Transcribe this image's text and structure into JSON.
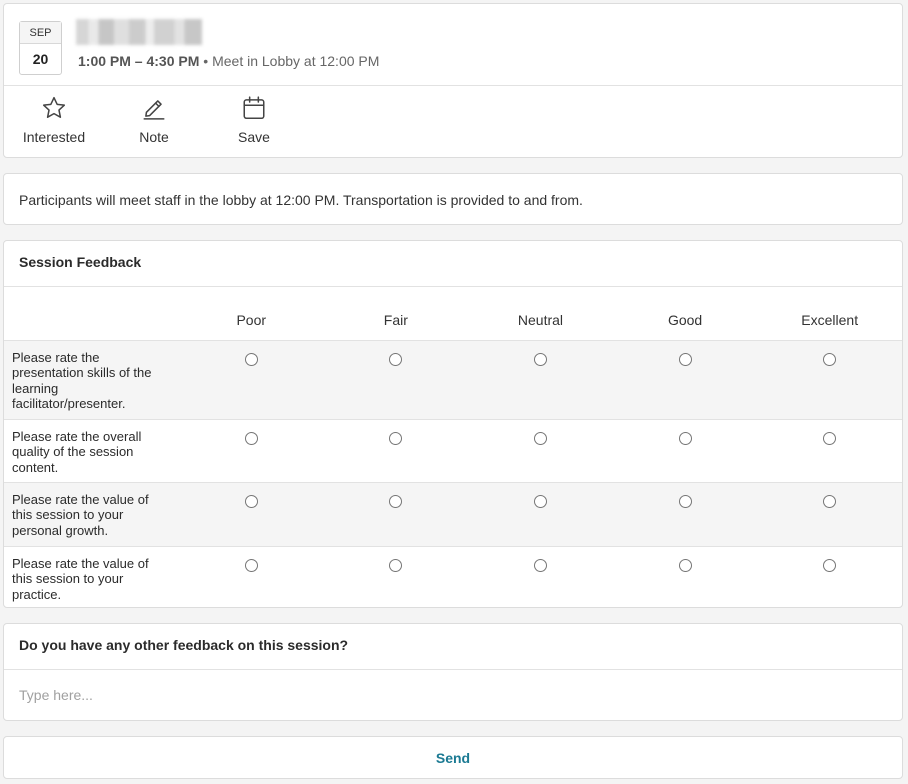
{
  "event": {
    "month": "SEP",
    "day": "20",
    "time_range": "1:00 PM – 4:30 PM",
    "separator": " • ",
    "location_note": "Meet in Lobby at 12:00 PM"
  },
  "actions": [
    {
      "label": "Interested",
      "icon": "star-icon"
    },
    {
      "label": "Note",
      "icon": "pencil-icon"
    },
    {
      "label": "Save",
      "icon": "calendar-icon"
    }
  ],
  "description": "Participants will meet staff in the lobby at 12:00 PM. Transportation is provided to and from.",
  "feedback": {
    "title": "Session Feedback",
    "scale": [
      "Poor",
      "Fair",
      "Neutral",
      "Good",
      "Excellent"
    ],
    "questions": [
      "Please rate the presentation skills of the learning facilitator/presenter.",
      "Please rate the overall quality of the session content.",
      "Please rate the value of this session to your personal growth.",
      "Please rate the value of this session to your practice."
    ]
  },
  "other_feedback": {
    "title": "Do you have any other feedback on this session?",
    "placeholder": "Type here...",
    "value": ""
  },
  "send_label": "Send",
  "colors": {
    "accent": "#1b7a93",
    "border": "#dcdcdc",
    "row_shade": "#f5f5f5"
  }
}
